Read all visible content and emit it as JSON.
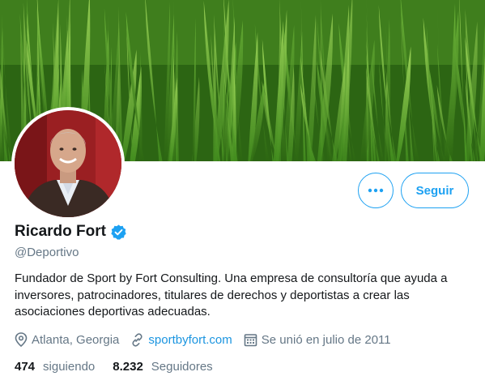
{
  "profile": {
    "name": "Ricardo Fort",
    "handle": "@Deportivo",
    "verified": true,
    "bio": "Fundador de Sport by Fort Consulting. Una empresa de consultoría que ayuda a inversores, patrocinadores, titulares de derechos y deportistas a crear las asociaciones deportivas adecuadas.",
    "location": "Atlanta, Georgia",
    "website": "sportbyfort.com",
    "joined": "Se unió en julio de 2011",
    "following_count": "474",
    "following_label": "siguiendo",
    "followers_count": "8.232",
    "followers_label": "Seguidores"
  },
  "actions": {
    "more_label": "•••",
    "follow_label": "Seguir"
  },
  "colors": {
    "accent": "#1da1f2",
    "link": "#1b95e0",
    "secondary_text": "#657786",
    "banner_grass": "#3d7a1c",
    "avatar_background": "#8e1c20"
  },
  "icons": {
    "location": "location-pin-icon",
    "website": "link-icon",
    "joined": "calendar-icon",
    "verified": "verified-badge-icon",
    "more": "more-dots-icon"
  }
}
